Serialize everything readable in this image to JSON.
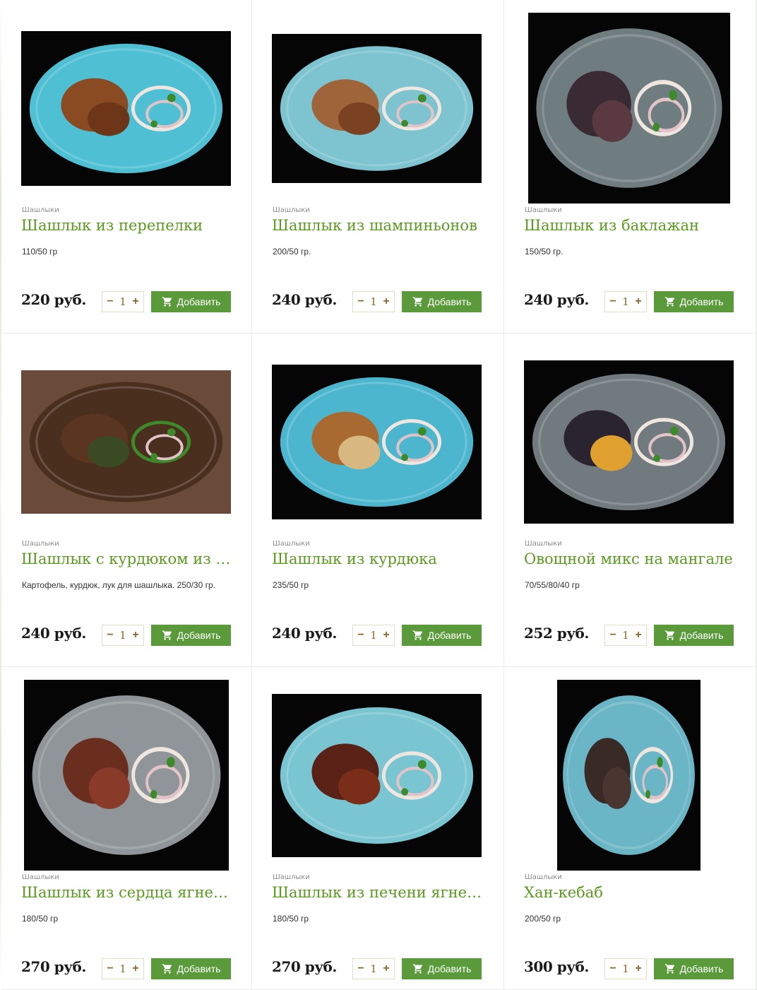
{
  "currency": "руб.",
  "add_label": "Добавить",
  "products": [
    {
      "category": "Шашлыки",
      "title": "Шашлык из перепелки",
      "desc": "110/50 гр",
      "price": "220 руб.",
      "qty": "1",
      "photo": {
        "plate": "#4fc0d4",
        "dark": false
      }
    },
    {
      "category": "Шашлыки",
      "title": "Шашлык из шампиньонов",
      "desc": "200/50 гр.",
      "price": "240 руб.",
      "qty": "1",
      "photo": {
        "plate": "#7dc4d0",
        "dark": false
      }
    },
    {
      "category": "Шашлыки",
      "title": "Шашлык из баклажан",
      "desc": "150/50 гр.",
      "price": "240 руб.",
      "qty": "1",
      "photo": {
        "plate": "#6f7c80",
        "dark": true
      }
    },
    {
      "category": "Шашлыки",
      "title": "Шашлык с курдюком из ка…",
      "desc": "Картофель, курдюк, лук для шашлыка. 250/30 гр.",
      "price": "240 руб.",
      "qty": "1",
      "photo": {
        "plate": "#5a3a28",
        "dark": true
      }
    },
    {
      "category": "Шашлыки",
      "title": "Шашлык из курдюка",
      "desc": "235/50 гр",
      "price": "240 руб.",
      "qty": "1",
      "photo": {
        "plate": "#4db6cf",
        "dark": false
      }
    },
    {
      "category": "Шашлыки",
      "title": "Овощной микс на мангале",
      "desc": "70/55/80/40 гр",
      "price": "252 руб.",
      "qty": "1",
      "photo": {
        "plate": "#717a7e",
        "dark": true
      }
    },
    {
      "category": "Шашлыки",
      "title": "Шашлык из сердца ягненка",
      "desc": "180/50 гр",
      "price": "270 руб.",
      "qty": "1",
      "photo": {
        "plate": "#8f9598",
        "dark": true
      }
    },
    {
      "category": "Шашлыки",
      "title": "Шашлык из печени ягненка",
      "desc": "180/50 гр",
      "price": "270 руб.",
      "qty": "1",
      "photo": {
        "plate": "#79c5d2",
        "dark": false
      }
    },
    {
      "category": "Шашлыки",
      "title": "Хан-кебаб",
      "desc": "200/50 гр",
      "price": "300 руб.",
      "qty": "1",
      "photo": {
        "plate": "#6ab5c6",
        "dark": false
      }
    }
  ]
}
